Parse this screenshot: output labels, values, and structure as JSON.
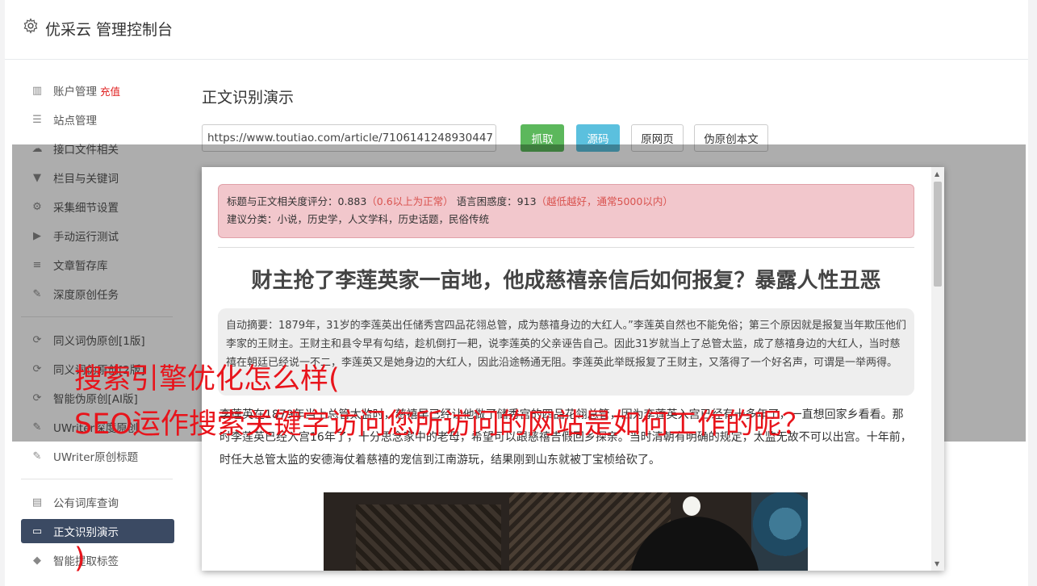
{
  "header": {
    "title": "优采云 管理控制台",
    "icon": "gear-icon"
  },
  "sidebar": {
    "items": [
      {
        "label": "账户管理",
        "extra": "充值",
        "icon": "bar-chart-icon"
      },
      {
        "label": "站点管理",
        "icon": "server-icon"
      },
      {
        "label": "接口文件相关",
        "icon": "cloud-upload-icon"
      },
      {
        "label": "栏目与关键词",
        "icon": "filter-icon"
      },
      {
        "label": "采集细节设置",
        "icon": "gears-icon"
      },
      {
        "label": "手动运行测试",
        "icon": "play-circle-icon"
      },
      {
        "label": "文章暂存库",
        "icon": "database-icon"
      },
      {
        "label": "深度原创任务",
        "icon": "edit-icon"
      },
      {
        "label": "同义词伪原创[1版]",
        "icon": "refresh-icon"
      },
      {
        "label": "同义词伪原创[2版]",
        "icon": "refresh-icon"
      },
      {
        "label": "智能伪原创[AI版]",
        "icon": "refresh-icon"
      },
      {
        "label": "UWriter深度原创",
        "icon": "edit-icon"
      },
      {
        "label": "UWriter原创标题",
        "icon": "edit-icon"
      },
      {
        "label": "公有词库查询",
        "icon": "book-icon"
      },
      {
        "label": "正文识别演示",
        "icon": "monitor-icon"
      },
      {
        "label": "智能提取标签",
        "icon": "tag-icon"
      }
    ]
  },
  "main": {
    "title": "正文识别演示",
    "url_value": "https://www.toutiao.com/article/7106141248930447",
    "buttons": {
      "grab": "抓取",
      "source": "源码",
      "original": "原网页",
      "pseudo": "伪原创本文"
    }
  },
  "modal": {
    "alert": {
      "line1_a": "标题与正文相关度评分：0.883",
      "line1_b": "（0.6以上为正常）",
      "line1_c": "语言困惑度：913",
      "line1_d": "（越低越好，通常5000以内）",
      "line2": "建议分类：小说，历史学，人文学科，历史话题，民俗传统"
    },
    "article_title": "财主抢了李莲英家一亩地，他成慈禧亲信后如何报复？暴露人性丑恶",
    "summary": "自动摘要：1879年，31岁的李莲英出任储秀宫四品花翎总管，成为慈禧身边的大红人。”李莲英自然也不能免俗；第三个原因就是报复当年欺压他们李家的王财主。王财主和县令早有勾结，趁机倒打一耙，说李莲英的父亲诬告自己。因此31岁就当上了总管太监，成了慈禧身边的大红人，当时慈禧在朝廷已经说一不二，李莲英又是她身边的大红人，因此沿途畅通无阻。李莲英此举既报复了王财主，又落得了一个好名声，可谓是一举两得。",
    "body": "李莲英在1879年当上总管太监时，慈禧早已经让他做了储秀宫的四品花翎总管，因为李莲英入宫已经有十多年了，一直想回家乡看看。那时李莲英已经入宫16年了，十分思念家中的老母，希望可以跟慈禧告假回乡探亲。当时清朝有明确的规定，太监无故不可以出宫。十年前，时任大总管太监的安德海仗着慈禧的宠信到江南游玩，结果刚到山东就被丁宝桢给砍了。"
  },
  "watermark": {
    "line1": "搜索引擎优化怎么样(",
    "line2": "SEO运作搜索关键字访问您所访问的网站是如何工作的呢？",
    "line3": ")"
  }
}
